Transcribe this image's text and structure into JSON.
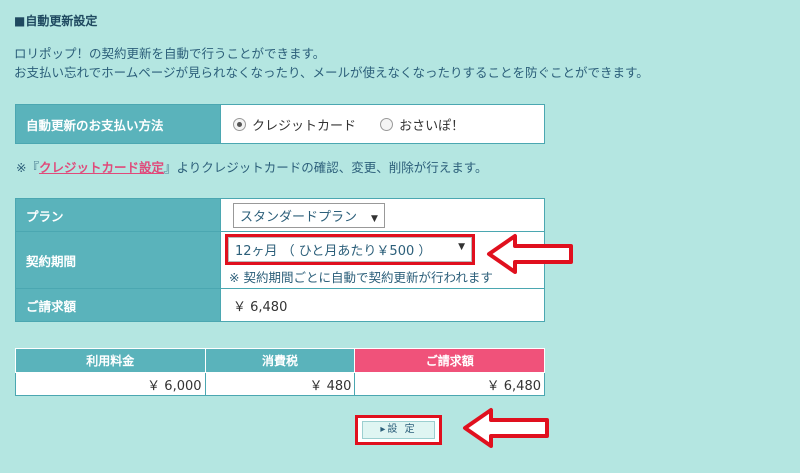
{
  "section_title": "■自動更新設定",
  "description": {
    "line1": "ロリポップ！の契約更新を自動で行うことができます。",
    "line2": "お支払い忘れでホームページが見られなくなったり、メールが使えなくなったりすることを防ぐことができます。"
  },
  "payment": {
    "label": "自動更新のお支払い方法",
    "options": [
      {
        "label": "クレジットカード",
        "selected": true
      },
      {
        "label": "おさいぽ！",
        "selected": false
      }
    ]
  },
  "credit_note": {
    "prefix": "※『",
    "link": "クレジットカード設定",
    "suffix": "』よりクレジットカードの確認、変更、削除が行えます。"
  },
  "plan": {
    "plan_label": "プラン",
    "plan_value": "スタンダードプラン",
    "period_label": "契約期間",
    "period_value": "12ヶ月 （ ひと月あたり￥500 ）",
    "period_note": "※ 契約期間ごとに自動で契約更新が行われます",
    "billing_label": "ご請求額",
    "billing_value": "￥ 6,480"
  },
  "fees": {
    "headers": [
      "利用料金",
      "消費税",
      "ご請求額"
    ],
    "values": [
      "￥ 6,000",
      "￥ 480",
      "￥ 6,480"
    ]
  },
  "submit_label": "▸設 定",
  "colors": {
    "background": "#b4e6e1",
    "header": "#5ab3bb",
    "accent_pink": "#f0527a",
    "highlight_red": "#e0101e"
  }
}
